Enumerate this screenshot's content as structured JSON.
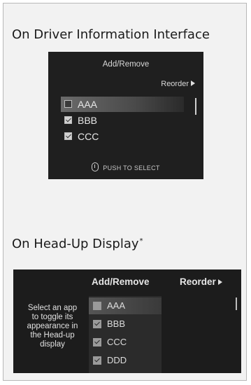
{
  "dii_section": {
    "title": "On Driver Information Interface",
    "screen": {
      "title": "Add/Remove",
      "reorder_label": "Reorder",
      "items": [
        {
          "label": "AAA",
          "checked": false,
          "selected": true
        },
        {
          "label": "BBB",
          "checked": true,
          "selected": false
        },
        {
          "label": "CCC",
          "checked": true,
          "selected": false
        }
      ],
      "push_label": "PUSH TO SELECT"
    }
  },
  "hud_section": {
    "title": "On Head-Up Display",
    "title_mark": "*",
    "screen": {
      "add_remove_label": "Add/Remove",
      "reorder_label": "Reorder",
      "hint_lines": [
        "Select an app",
        "to toggle its",
        "appearance in",
        "the Head-up",
        "display"
      ],
      "items": [
        {
          "label": "AAA",
          "checked": false,
          "selected": true
        },
        {
          "label": "BBB",
          "checked": true,
          "selected": false
        },
        {
          "label": "CCC",
          "checked": true,
          "selected": false
        },
        {
          "label": "DDD",
          "checked": true,
          "selected": false
        }
      ]
    }
  }
}
